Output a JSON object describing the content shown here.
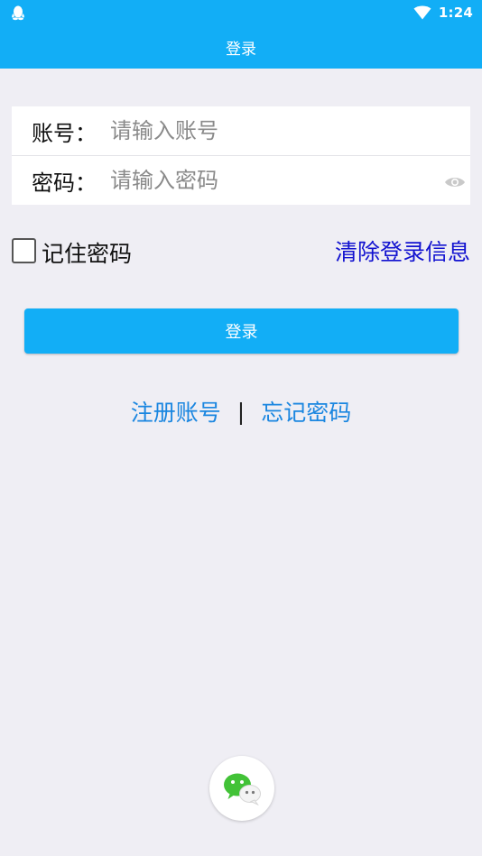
{
  "status_bar": {
    "time": "1:24",
    "left_icon": "qq-penguin-icon",
    "right_icons": [
      "wifi-icon"
    ]
  },
  "header": {
    "title": "登录"
  },
  "form": {
    "account": {
      "label": "账号：",
      "value": "",
      "placeholder": "请输入账号"
    },
    "password": {
      "label": "密码：",
      "value": "",
      "placeholder": "请输入密码",
      "toggle_icon": "eye-icon"
    }
  },
  "options": {
    "remember_label": "记住密码",
    "remember_checked": false,
    "clear_label": "清除登录信息"
  },
  "login_button": {
    "label": "登录"
  },
  "links": {
    "register": "注册账号",
    "separator": "|",
    "forgot": "忘记密码"
  },
  "social": {
    "wechat_icon": "wechat-icon"
  },
  "colors": {
    "primary": "#12aef6",
    "background": "#efeef4",
    "link_blue": "#1a86e0",
    "clear_link": "#1212d0",
    "wechat_green": "#42c237"
  }
}
